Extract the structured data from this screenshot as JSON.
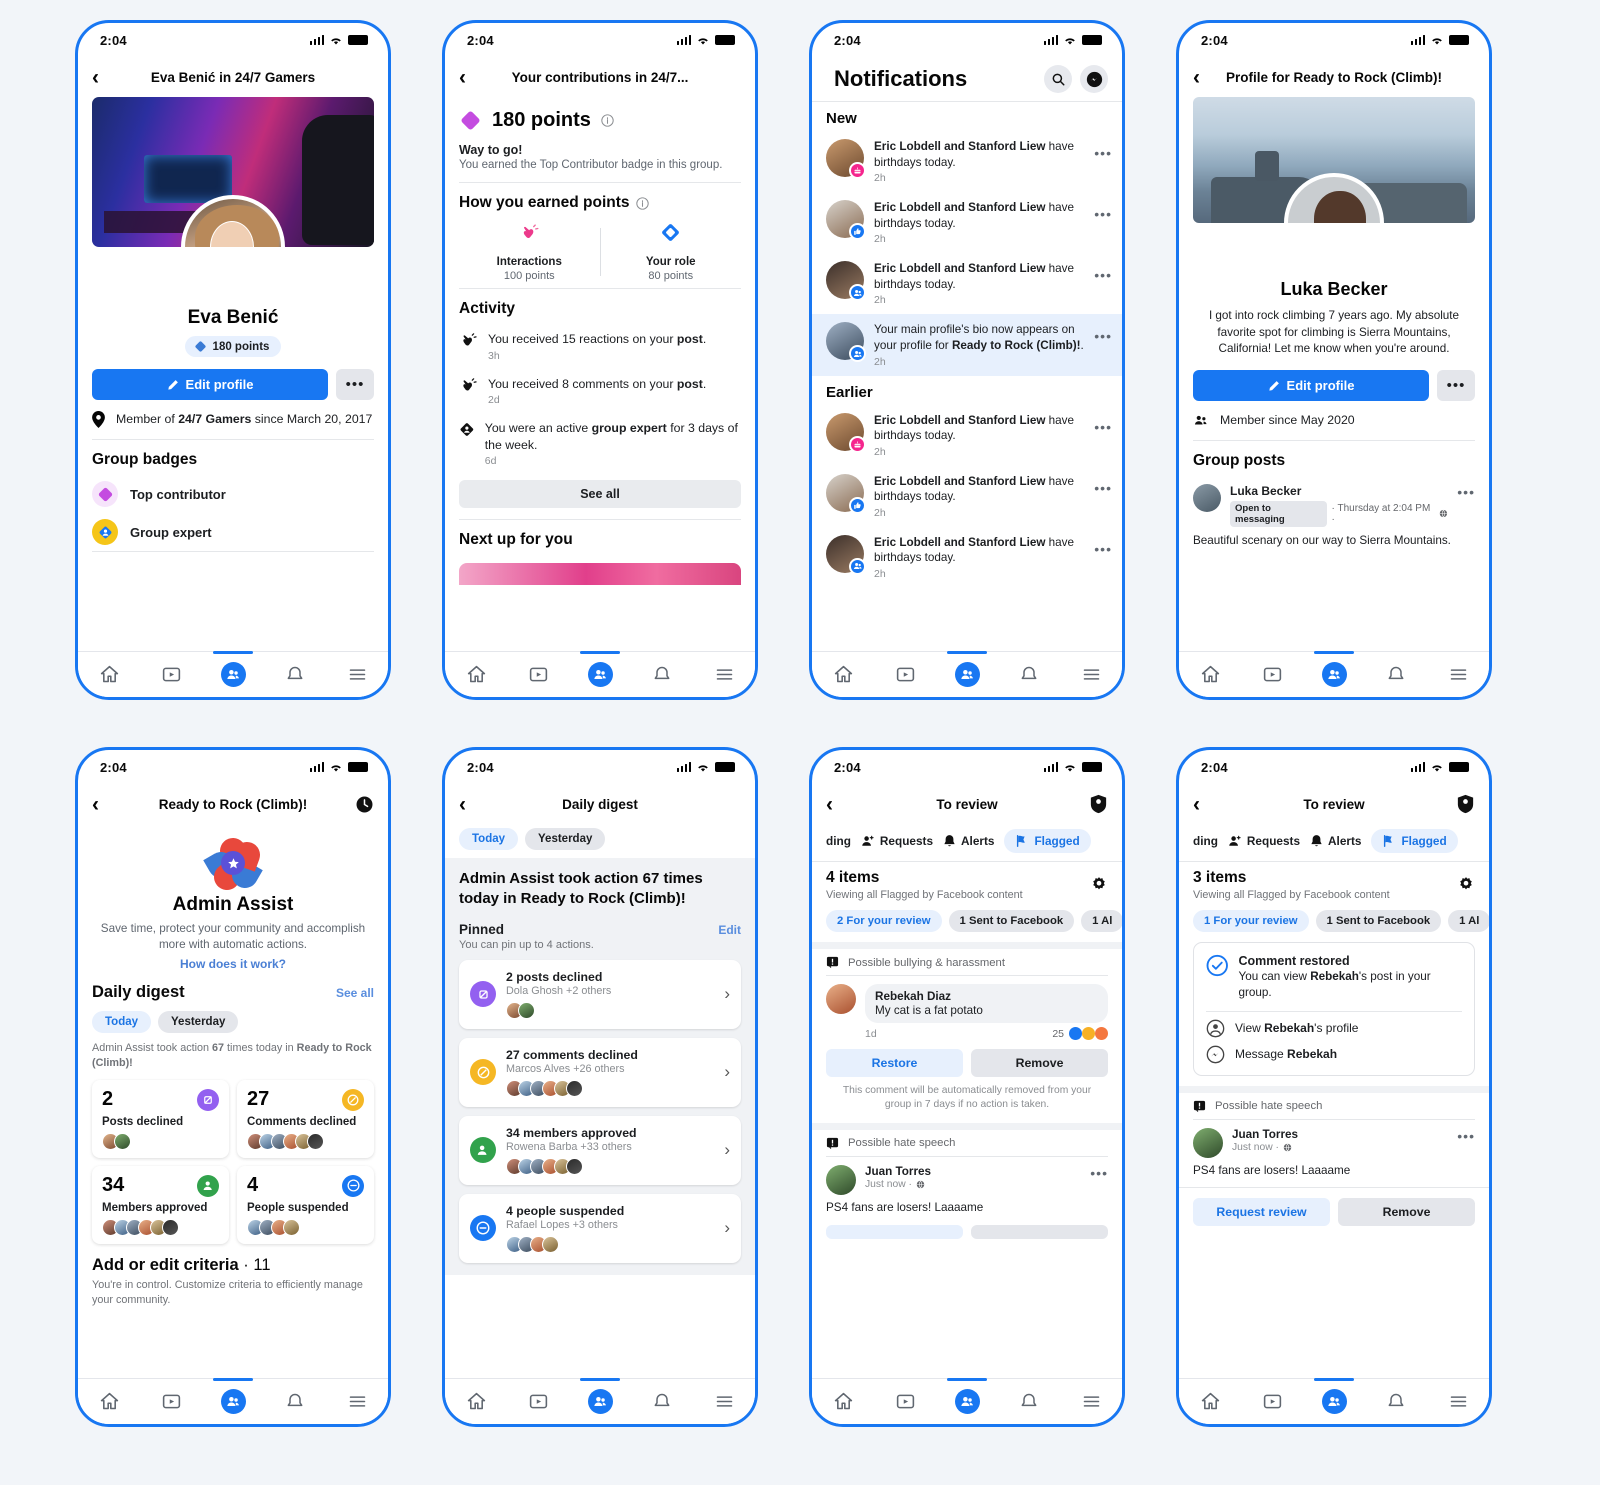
{
  "status": {
    "time": "2:04"
  },
  "phone1": {
    "nav_title": "Eva Benić in 24/7 Gamers",
    "name": "Eva Benić",
    "points_chip": "180 points",
    "edit_profile": "Edit profile",
    "more": "•••",
    "member_line_prefix": "Member of ",
    "member_group": "24/7 Gamers",
    "member_line_suffix": " since March 20, 2017",
    "badges_title": "Group badges",
    "badges": [
      {
        "label": "Top contributor",
        "color": "#c44ce0"
      },
      {
        "label": "Group expert",
        "color": "#f5c518"
      }
    ]
  },
  "phone2": {
    "nav_title": "Your contributions in  24/7...",
    "points": "180 points",
    "way_to_go": "Way to go!",
    "earned_badge_note": "You earned the Top Contributor badge in this group.",
    "how_earned_title": "How you earned points",
    "earned": [
      {
        "label": "Interactions",
        "sub": "100 points"
      },
      {
        "label": "Your role",
        "sub": "80 points"
      }
    ],
    "activity_title": "Activity",
    "activities": [
      {
        "pre": "You received 15 reactions on your ",
        "b": "post",
        "post": ".",
        "time": "3h",
        "icon": "clap-icon"
      },
      {
        "pre": "You received 8 comments on your ",
        "b": "post",
        "post": ".",
        "time": "2d",
        "icon": "clap-icon"
      },
      {
        "pre": "You were an active ",
        "b": "group expert",
        "post": " for 3 days of the week.",
        "time": "6d",
        "icon": "expert-icon"
      }
    ],
    "see_all": "See all",
    "next_up_title": "Next up for you"
  },
  "phone3": {
    "title": "Notifications",
    "section_new": "New",
    "section_earlier": "Earlier",
    "new_items": [
      {
        "names": "Eric Lobdell and Stanford Liew",
        "text": " have birthdays today.",
        "time": "2h",
        "badge": "cake-icon",
        "badge_color": "#f5258d",
        "av": "avg1"
      },
      {
        "names": "Eric Lobdell and Stanford Liew",
        "text": " have birthdays today.",
        "time": "2h",
        "badge": "thumbs-up-icon",
        "badge_color": "#1877f2",
        "av": "avg2"
      },
      {
        "names": "Eric Lobdell and Stanford Liew",
        "text": " have birthdays today.",
        "time": "2h",
        "badge": "group-icon",
        "badge_color": "#1877f2",
        "av": "avg3"
      }
    ],
    "highlight": {
      "pre": "Your main profile's bio now appears on your profile for ",
      "b": "Ready to Rock (Climb)!",
      "post": ".",
      "time": "2h",
      "badge": "group-icon",
      "badge_color": "#1877f2",
      "av": "avg4"
    },
    "earlier_items": [
      {
        "names": "Eric Lobdell and Stanford Liew",
        "text": " have birthdays today.",
        "time": "2h",
        "badge": "cake-icon",
        "badge_color": "#f5258d",
        "av": "avg1"
      },
      {
        "names": "Eric Lobdell and Stanford Liew",
        "text": " have birthdays today.",
        "time": "2h",
        "badge": "thumbs-up-icon",
        "badge_color": "#1877f2",
        "av": "avg2"
      },
      {
        "names": "Eric Lobdell and Stanford Liew",
        "text": " have birthdays today.",
        "time": "2h",
        "badge": "group-icon",
        "badge_color": "#1877f2",
        "av": "avg3"
      }
    ]
  },
  "phone4": {
    "nav_title": "Profile for Ready to Rock (Climb)!",
    "name": "Luka Becker",
    "bio": "I got into rock climbing 7 years ago. My absolute favorite spot for climbing is Sierra Mountains, California! Let me know when you're around.",
    "edit_profile": "Edit profile",
    "more": "•••",
    "member_since": "Member since May 2020",
    "group_posts_title": "Group posts",
    "post": {
      "author": "Luka Becker",
      "tag": "Open to messaging",
      "meta": "· Thursday at 2:04 PM · ",
      "body": "Beautiful scenary on our way to Sierra Mountains."
    }
  },
  "phone5": {
    "nav_title": "Ready to Rock (Climb)!",
    "aa_title": "Admin Assist",
    "aa_sub": "Save time, protect your community and accomplish more with automatic actions.",
    "aa_link": "How does it work?",
    "dd_title": "Daily digest",
    "dd_seeall": "See all",
    "chips": [
      "Today",
      "Yesterday"
    ],
    "dd_note_pre": "Admin Assist took action ",
    "dd_note_n": "67",
    "dd_note_mid": " times today in ",
    "dd_note_group": "Ready to Rock (Climb)!",
    "stats": [
      {
        "n": "2",
        "label": "Posts declined",
        "color": "#9360f0",
        "faces": [
          "avg5",
          "avg6"
        ]
      },
      {
        "n": "27",
        "label": "Comments declined",
        "color": "#f5b724",
        "faces": [
          "avg7",
          "avg10",
          "avg4",
          "avg12",
          "avg9",
          "avg11"
        ]
      },
      {
        "n": "34",
        "label": "Members approved",
        "color": "#31a24c",
        "faces": [
          "avg7",
          "avg10",
          "avg4",
          "avg12",
          "avg9",
          "avg11"
        ]
      },
      {
        "n": "4",
        "label": "People suspended",
        "color": "#1877f2",
        "faces": [
          "avg10",
          "avg4",
          "avg12",
          "avg9"
        ]
      }
    ],
    "crit_title": "Add or edit criteria",
    "crit_count": "· 11",
    "crit_sub": "You're in control. Customize criteria to efficiently manage your community."
  },
  "phone6": {
    "nav_title": "Daily digest",
    "chips": [
      "Today",
      "Yesterday"
    ],
    "band_head": "Admin Assist took action 67 times today in Ready to Rock (Climb)!",
    "pinned_title": "Pinned",
    "pinned_edit": "Edit",
    "pinned_sub": "You can pin up to 4 actions.",
    "cards": [
      {
        "title": "2 posts declined",
        "sub": "Dola Ghosh +2 others",
        "color": "#9360f0",
        "faces": [
          "avg5",
          "avg6"
        ]
      },
      {
        "title": "27 comments declined",
        "sub": "Marcos Alves +26 others",
        "color": "#f5b724",
        "faces": [
          "avg7",
          "avg10",
          "avg4",
          "avg12",
          "avg9",
          "avg11"
        ]
      },
      {
        "title": "34 members approved",
        "sub": "Rowena Barba +33 others",
        "color": "#31a24c",
        "faces": [
          "avg7",
          "avg10",
          "avg4",
          "avg12",
          "avg9",
          "avg11"
        ]
      },
      {
        "title": "4 people suspended",
        "sub": "Rafael Lopes +3 others",
        "color": "#1877f2",
        "faces": [
          "avg10",
          "avg4",
          "avg12",
          "avg9"
        ]
      }
    ]
  },
  "phone7": {
    "nav_title": "To review",
    "tabs": [
      "ding",
      "Requests",
      "Alerts",
      "Flagged"
    ],
    "items_count": "4 items",
    "items_sub": "Viewing all Flagged by Facebook content",
    "filter_chips": [
      "2 For your review",
      "1 Sent to Facebook",
      "1 Al"
    ],
    "section1_flag": "Possible bullying & harassment",
    "comment": {
      "name": "Rebekah Diaz",
      "text": "My cat is a fat potato",
      "time": "1d",
      "reactions": "25"
    },
    "actions": [
      "Restore",
      "Remove"
    ],
    "note": "This comment will be automatically removed from your group in 7 days if no action is taken.",
    "section2_flag": "Possible hate speech",
    "post": {
      "name": "Juan Torres",
      "meta": "Just now · ",
      "body": "PS4 fans are losers! Laaaame"
    }
  },
  "phone8": {
    "nav_title": "To review",
    "tabs": [
      "ding",
      "Requests",
      "Alerts",
      "Flagged"
    ],
    "items_count": "3 items",
    "items_sub": "Viewing all Flagged by Facebook content",
    "filter_chips": [
      "1 For your review",
      "1 Sent to Facebook",
      "1 Al"
    ],
    "restored": {
      "title": "Comment restored",
      "sub_pre": "You can view ",
      "sub_b": "Rebekah",
      "sub_post": "'s post in your group.",
      "view_pre": "View ",
      "view_b": "Rebekah",
      "view_post": "'s profile",
      "msg_pre": "Message ",
      "msg_b": "Rebekah"
    },
    "section_flag": "Possible hate speech",
    "post": {
      "name": "Juan Torres",
      "meta": "Just now · ",
      "body": "PS4 fans are losers! Laaaame"
    },
    "actions": [
      "Request review",
      "Remove"
    ]
  }
}
